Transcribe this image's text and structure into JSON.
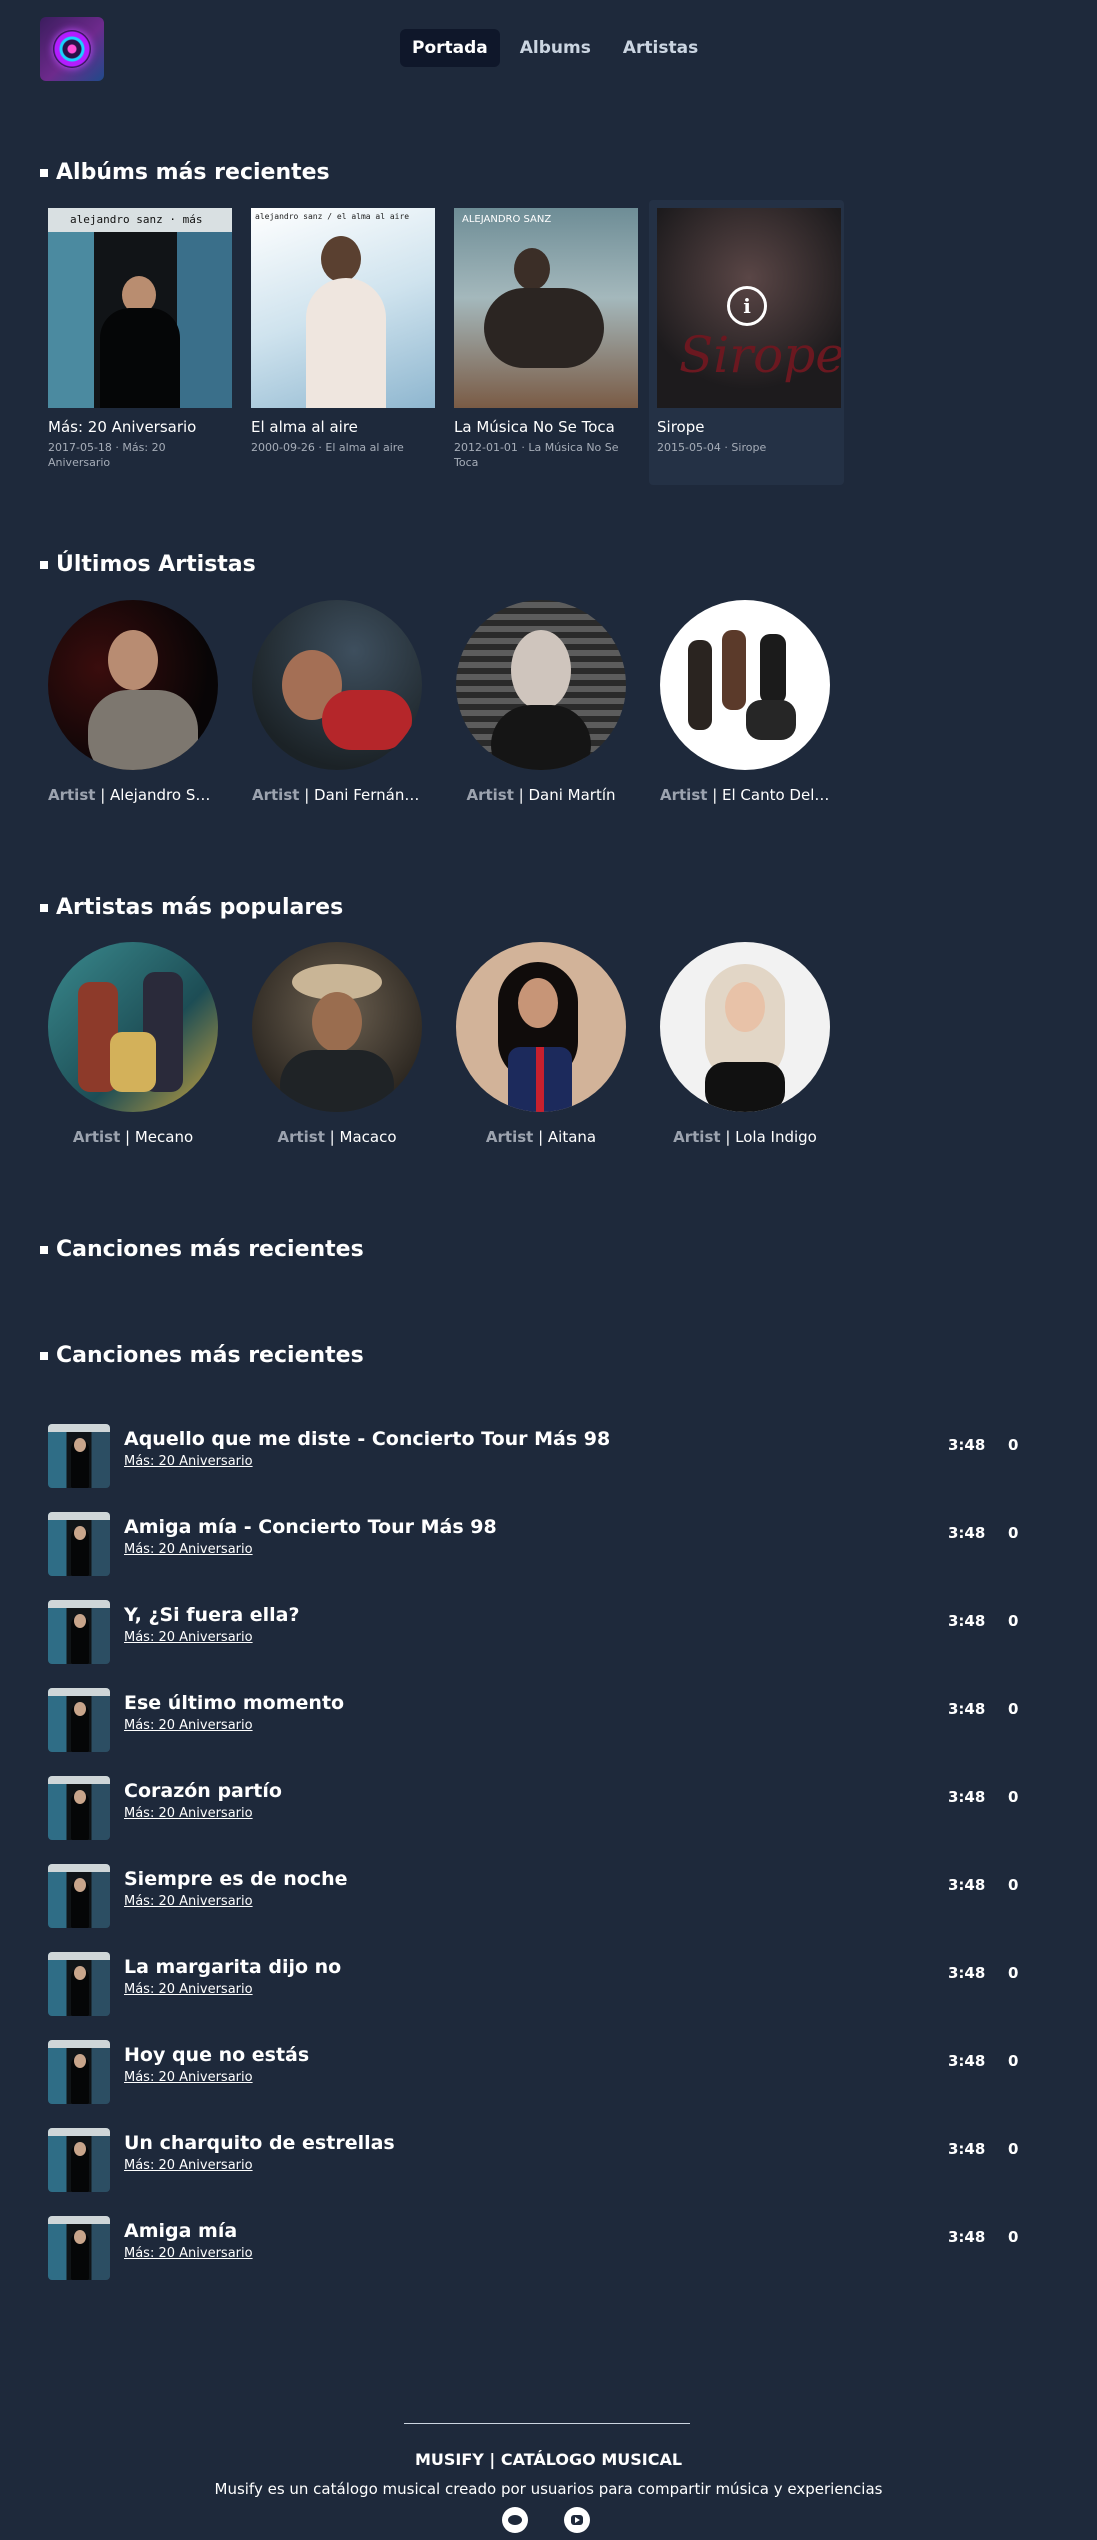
{
  "nav": {
    "tabs": [
      {
        "label": "Portada",
        "active": true
      },
      {
        "label": "Albums",
        "active": false
      },
      {
        "label": "Artistas",
        "active": false
      }
    ]
  },
  "sections": {
    "recent_albums": "Albúms más recientes",
    "latest_artists": "Últimos Artistas",
    "popular_artists": "Artistas más populares",
    "recent_songs_1": "Canciones más recientes",
    "recent_songs_2": "Canciones más recientes"
  },
  "albums": [
    {
      "title": "Más: 20 Aniversario",
      "meta": "2017-05-18 · Más: 20 Aniversario",
      "cover_text": "alejandro sanz · más"
    },
    {
      "title": "El alma al aire",
      "meta": "2000-09-26 · El alma al aire",
      "cover_text": "alejandro sanz / el alma al aire"
    },
    {
      "title": "La Música No Se Toca",
      "meta": "2012-01-01 · La Música No Se Toca",
      "cover_text": "ALEJANDRO SANZ"
    },
    {
      "title": "Sirope",
      "meta": "2015-05-04 · Sirope",
      "cover_text": "Sirope"
    }
  ],
  "artist_tag": "Artist",
  "latest_artists": [
    {
      "name": "Alejandro Sanz"
    },
    {
      "name": "Dani Fernández"
    },
    {
      "name": "Dani Martín"
    },
    {
      "name": "El Canto Del Loco"
    }
  ],
  "popular_artists": [
    {
      "name": "Mecano"
    },
    {
      "name": "Macaco"
    },
    {
      "name": "Aitana"
    },
    {
      "name": "Lola Indigo"
    }
  ],
  "songs": [
    {
      "title": "Aquello que me diste - Concierto Tour Más 98",
      "album": "Más: 20 Aniversario",
      "duration": "3:48",
      "plays": "0"
    },
    {
      "title": "Amiga mía - Concierto Tour Más 98",
      "album": "Más: 20 Aniversario",
      "duration": "3:48",
      "plays": "0"
    },
    {
      "title": "Y, ¿Si fuera ella?",
      "album": "Más: 20 Aniversario",
      "duration": "3:48",
      "plays": "0"
    },
    {
      "title": "Ese último momento",
      "album": "Más: 20 Aniversario",
      "duration": "3:48",
      "plays": "0"
    },
    {
      "title": "Corazón partío",
      "album": "Más: 20 Aniversario",
      "duration": "3:48",
      "plays": "0"
    },
    {
      "title": "Siempre es de noche",
      "album": "Más: 20 Aniversario",
      "duration": "3:48",
      "plays": "0"
    },
    {
      "title": "La margarita dijo no",
      "album": "Más: 20 Aniversario",
      "duration": "3:48",
      "plays": "0"
    },
    {
      "title": "Hoy que no estás",
      "album": "Más: 20 Aniversario",
      "duration": "3:48",
      "plays": "0"
    },
    {
      "title": "Un charquito de estrellas",
      "album": "Más: 20 Aniversario",
      "duration": "3:48",
      "plays": "0"
    },
    {
      "title": "Amiga mía",
      "album": "Más: 20 Aniversario",
      "duration": "3:48",
      "plays": "0"
    }
  ],
  "footer": {
    "brand": "MUSIFY | CATÁLOGO MUSICAL",
    "description": "Musify es un catálogo musical creado por usuarios para compartir música y experiencias",
    "icons": [
      "github-icon",
      "youtube-icon"
    ]
  }
}
